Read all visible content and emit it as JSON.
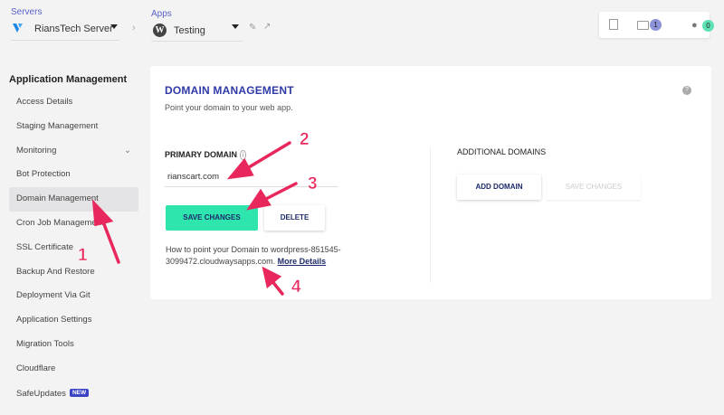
{
  "header": {
    "servers_label": "Servers",
    "server_name": "RiansTech Server",
    "apps_label": "Apps",
    "app_name": "Testing",
    "folder_count": "1",
    "user_count": "0"
  },
  "sidebar": {
    "title": "Application Management",
    "items": [
      {
        "label": "Access Details"
      },
      {
        "label": "Staging Management"
      },
      {
        "label": "Monitoring"
      },
      {
        "label": "Bot Protection"
      },
      {
        "label": "Domain Management",
        "active": true
      },
      {
        "label": "Cron Job Management"
      },
      {
        "label": "SSL Certificate"
      },
      {
        "label": "Backup And Restore"
      },
      {
        "label": "Deployment Via Git"
      },
      {
        "label": "Application Settings"
      },
      {
        "label": "Migration Tools"
      },
      {
        "label": "Cloudflare"
      },
      {
        "label": "SafeUpdates",
        "badge": "NEW"
      }
    ]
  },
  "main": {
    "title": "DOMAIN MANAGEMENT",
    "subtitle": "Point your domain to your web app.",
    "primary_label": "PRIMARY DOMAIN",
    "primary_value": "rianscart.com",
    "save_label": "SAVE CHANGES",
    "delete_label": "DELETE",
    "help_text": "How to point your Domain to wordpress-851545-3099472.cloudwaysapps.com.",
    "more_link": "More Details",
    "additional_label": "ADDITIONAL DOMAINS",
    "add_label": "ADD DOMAIN",
    "save2_label": "SAVE CHANGES"
  },
  "annotations": [
    "1",
    "2",
    "3",
    "4"
  ],
  "colors": {
    "accent": "#2f3aa8",
    "save": "#2ee6ad",
    "annotation": "#e8285c"
  }
}
